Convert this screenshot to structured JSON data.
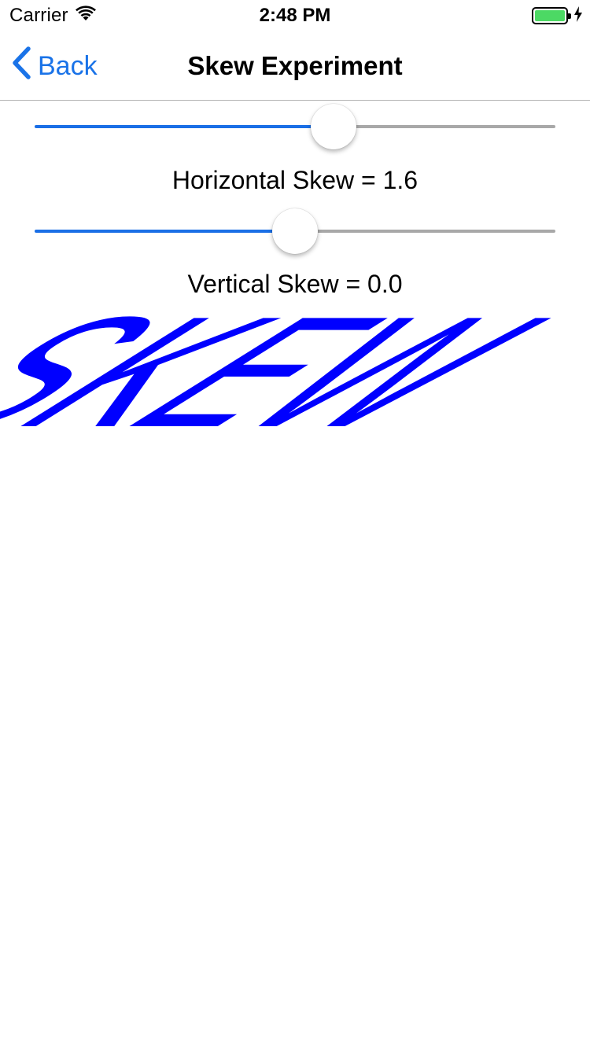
{
  "status_bar": {
    "carrier": "Carrier",
    "time": "2:48 PM",
    "wifi_icon": "wifi-icon",
    "battery_icon": "battery-icon",
    "charging_icon": "charging-bolt-icon"
  },
  "nav": {
    "back_label": "Back",
    "back_icon": "chevron-left-icon",
    "title": "Skew Experiment"
  },
  "horizontal_skew": {
    "label": "Horizontal Skew = 1.6",
    "slider_value_fraction": 0.574
  },
  "vertical_skew": {
    "label": "Vertical Skew = 0.0",
    "slider_value_fraction": 0.5
  },
  "canvas": {
    "text": "SKEW",
    "text_color": "#0000ff",
    "skew_x": 1.6,
    "skew_y": 0.0
  },
  "colors": {
    "tint": "#1a73e8",
    "slider_min_track": "#1a6fe6",
    "slider_max_track": "#a8a8a8"
  }
}
